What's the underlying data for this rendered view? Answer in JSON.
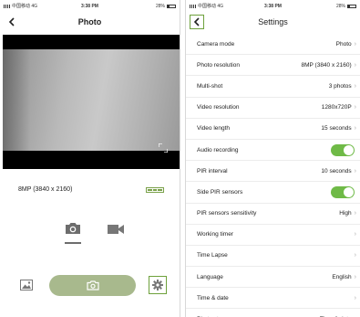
{
  "left_screen": {
    "status": {
      "carrier": "中国移动 4G",
      "time": "3:38 PM",
      "battery": "28%"
    },
    "nav": {
      "title": "Photo"
    },
    "preview": {
      "resolution": "8MP (3840 x 2160)"
    },
    "modes": {
      "photo_icon": "camera-icon",
      "video_icon": "video-camera-icon",
      "active": "photo"
    }
  },
  "right_screen": {
    "status": {
      "carrier": "中国移动 4G",
      "time": "3:38 PM",
      "battery": "28%"
    },
    "nav": {
      "title": "Settings"
    },
    "rows": [
      {
        "label": "Camera mode",
        "value": "Photo"
      },
      {
        "label": "Photo resolution",
        "value": "8MP (3840 x 2160)"
      },
      {
        "label": "Multi-shot",
        "value": "3 photos"
      },
      {
        "label": "Video resolution",
        "value": "1280x720P"
      },
      {
        "label": "Video length",
        "value": "15 seconds"
      },
      {
        "label": "Audio recording",
        "toggle": true
      },
      {
        "label": "PIR interval",
        "value": "10 seconds"
      },
      {
        "label": "Side PIR sensors",
        "toggle": true
      },
      {
        "label": "PIR sensors sensitivity",
        "value": "High"
      },
      {
        "label": "Working timer",
        "value": ""
      },
      {
        "label": "Time Lapse",
        "value": ""
      },
      {
        "label": "Language",
        "value": "English"
      },
      {
        "label": "Time & date",
        "value": ""
      },
      {
        "label": "Photo stamp",
        "value": "Time & date"
      }
    ]
  },
  "colors": {
    "accent_green": "#6ea13c",
    "toggle_green": "#6fba47",
    "shutter_green": "#a8b98d"
  }
}
